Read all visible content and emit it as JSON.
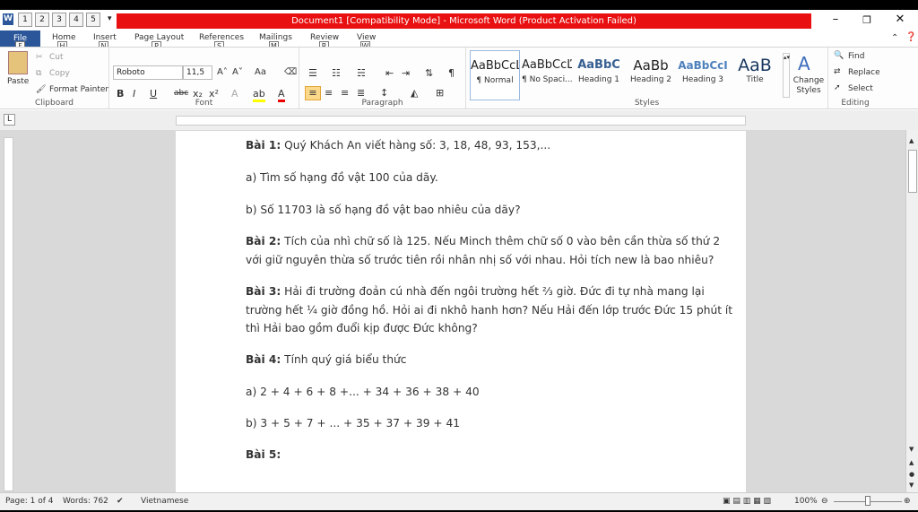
{
  "title": {
    "app_icon": "W",
    "text": "Document1 [Compatibility Mode] - Microsoft Word (Product Activation Failed)",
    "qat": [
      "1",
      "2",
      "3",
      "4",
      "5"
    ]
  },
  "tabs": [
    {
      "label": "File",
      "tip": "F"
    },
    {
      "label": "Home",
      "tip": "H"
    },
    {
      "label": "Insert",
      "tip": "N"
    },
    {
      "label": "Page Layout",
      "tip": "P"
    },
    {
      "label": "References",
      "tip": "S"
    },
    {
      "label": "Mailings",
      "tip": "M"
    },
    {
      "label": "Review",
      "tip": "R"
    },
    {
      "label": "View",
      "tip": "W"
    }
  ],
  "clipboard": {
    "paste": "Paste",
    "cut": "Cut",
    "copy": "Copy",
    "format_painter": "Format Painter",
    "label": "Clipboard"
  },
  "font": {
    "name": "Roboto",
    "size": "11,5",
    "label": "Font",
    "aa": "Aa"
  },
  "paragraph": {
    "label": "Paragraph"
  },
  "styles": {
    "label": "Styles",
    "items": [
      {
        "preview": "AaBbCcĽ",
        "name": "¶ Normal"
      },
      {
        "preview": "AaBbCcĽ",
        "name": "¶ No Spaci..."
      },
      {
        "preview": "AaBbC",
        "name": "Heading 1"
      },
      {
        "preview": "AaBb",
        "name": "Heading 2"
      },
      {
        "preview": "AaBbCcI",
        "name": "Heading 3"
      },
      {
        "preview": "AaB",
        "name": "Title"
      }
    ],
    "change": "Change Styles"
  },
  "editing": {
    "label": "Editing",
    "find": "Find",
    "replace": "Replace",
    "select": "Select"
  },
  "doc": {
    "p1_bold": "Bài 1:",
    "p1": " Quý Khách  An viết hàng số: 3, 18, 48, 93, 153,...",
    "p2": "a) Tìm số hạng đồ vật 100 của dãy.",
    "p3": "b) Số 11703  là số hạng đồ vật bao nhiêu của dãy?",
    "p4_bold": "Bài 2:",
    "p4a": " Tích của nhì chữ số là 125.  Nếu Minch thêm chữ số 0 vào bên cần thừa số thứ 2",
    "p4b": "với giữ nguyên  thừa số trước tiên rồi nhân nhị số với nhau.  Hỏi tích new là bao nhiêu?",
    "p5_bold": "Bài 3:",
    "p5a": " Hải đi trường đoản cú nhà đến ngôi trường hết ⅔ giờ. Đức đi tự nhà mang lại",
    "p5b": "trường hết ¼ giờ đồng hồ. Hỏi ai đi nkhô hanh hơn? Nếu Hải đến lớp trước Đức 15 phút ít",
    "p5c": "thì Hải bao gồm đuổi kịp được Đức không?",
    "p6_bold": "Bài 4:",
    "p6": " Tính quý giá biểu thức",
    "p7": "a) 2 + 4 + 6 + 8 +... + 34 + 36 + 38 + 40",
    "p8": "b) 3 + 5 + 7 + ... + 35 + 37 + 39 + 41",
    "p9_bold": "Bài 5:"
  },
  "status": {
    "page": "Page: 1 of 4",
    "words": "Words: 762",
    "lang": "Vietnamese",
    "zoom": "100%"
  }
}
